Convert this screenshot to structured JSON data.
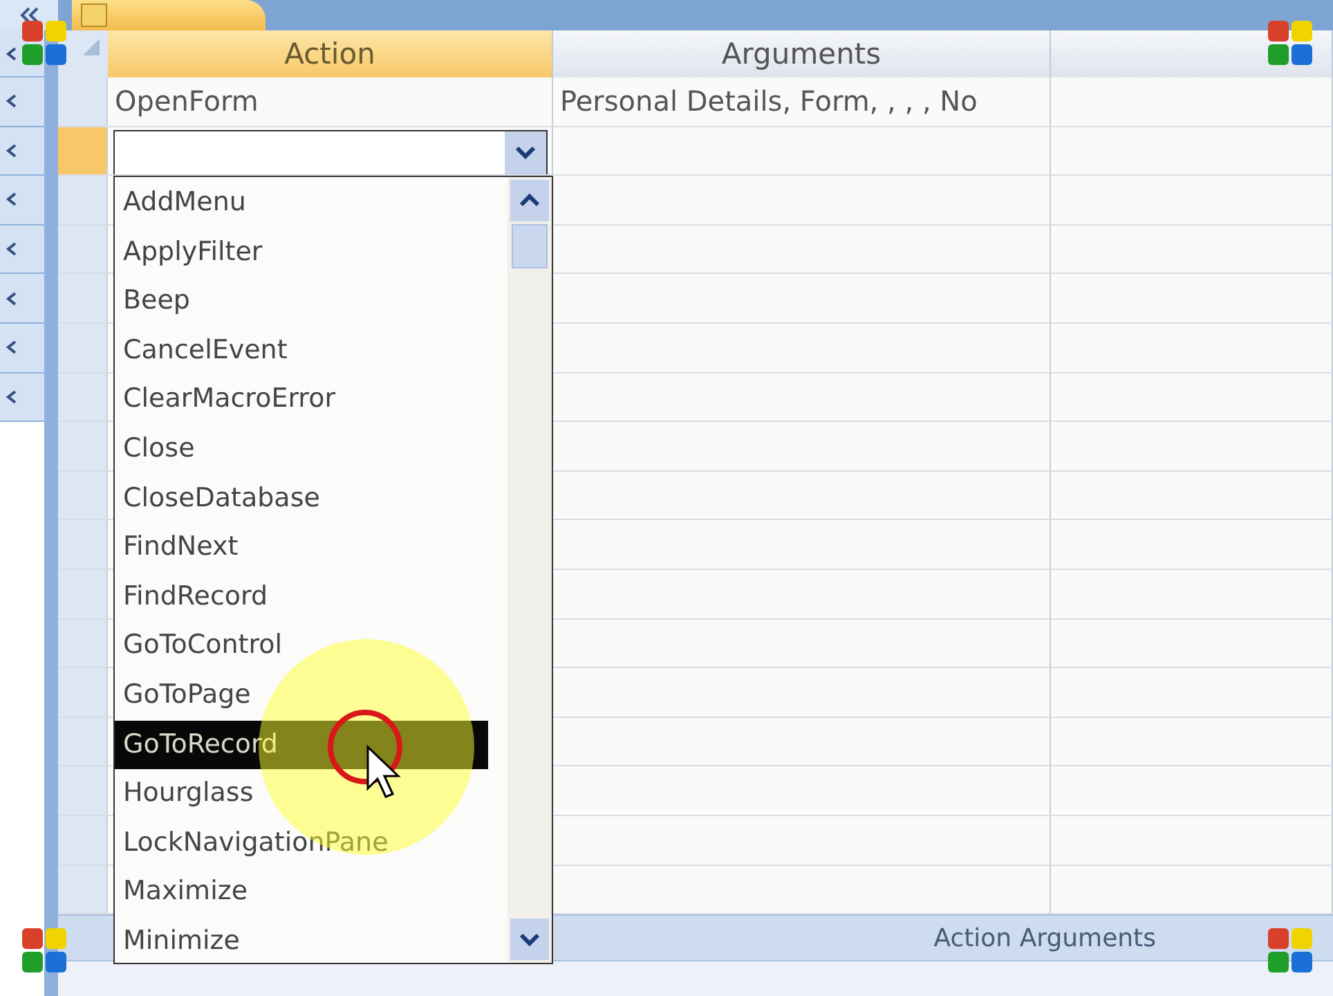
{
  "document_tab": {
    "selected": true
  },
  "columns": [
    {
      "label": "Action",
      "selected": true
    },
    {
      "label": "Arguments",
      "selected": false
    }
  ],
  "rows": [
    {
      "kind": "text",
      "selected": false,
      "action": "OpenForm",
      "arguments": "Personal Details, Form, , , , No"
    },
    {
      "kind": "field",
      "selected": true,
      "expanded": true
    }
  ],
  "dropdown": {
    "items": [
      {
        "label": "AddMenu",
        "selected": false
      },
      {
        "label": "ApplyFilter",
        "selected": false
      },
      {
        "label": "Beep",
        "selected": false
      },
      {
        "label": "CancelEvent",
        "selected": false
      },
      {
        "label": "ClearMacroError",
        "selected": false
      },
      {
        "label": "Close",
        "selected": false
      },
      {
        "label": "CloseDatabase",
        "selected": false
      },
      {
        "label": "FindNext",
        "selected": false
      },
      {
        "label": "FindRecord",
        "selected": false
      },
      {
        "label": "GoToControl",
        "selected": false
      },
      {
        "label": "GoToPage",
        "selected": false
      },
      {
        "label": "GoToRecord",
        "selected": true
      },
      {
        "label": "Hourglass",
        "selected": false
      },
      {
        "label": "LockNavigationPane",
        "selected": false
      },
      {
        "label": "Maximize",
        "selected": false
      },
      {
        "label": "Minimize",
        "selected": false
      }
    ]
  },
  "pane_title": "Action Arguments"
}
